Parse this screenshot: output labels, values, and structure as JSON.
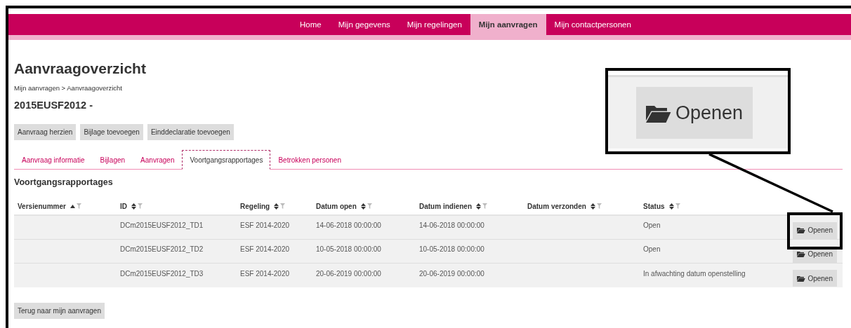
{
  "nav": {
    "items": [
      {
        "label": "Home",
        "selected": false
      },
      {
        "label": "Mijn gegevens",
        "selected": false
      },
      {
        "label": "Mijn regelingen",
        "selected": false
      },
      {
        "label": "Mijn aanvragen",
        "selected": true
      },
      {
        "label": "Mijn contactpersonen",
        "selected": false
      }
    ]
  },
  "title": "Aanvraagoverzicht",
  "breadcrumb": "Mijn aanvragen > Aanvraagoverzicht",
  "case_id": "2015EUSF2012 -",
  "actions": [
    "Aanvraag herzien",
    "Bijlage toevoegen",
    "Einddeclaratie toevoegen"
  ],
  "tabs": [
    {
      "label": "Aanvraag informatie",
      "selected": false
    },
    {
      "label": "Bijlagen",
      "selected": false
    },
    {
      "label": "Aanvragen",
      "selected": false
    },
    {
      "label": "Voortgangsrapportages",
      "selected": true
    },
    {
      "label": "Betrokken personen",
      "selected": false
    }
  ],
  "section_title": "Voortgangsrapportages",
  "table": {
    "columns": [
      {
        "label": "Versienummer",
        "sorted": true
      },
      {
        "label": "ID",
        "sorted": false
      },
      {
        "label": "Regeling",
        "sorted": false
      },
      {
        "label": "Datum open",
        "sorted": false
      },
      {
        "label": "Datum indienen",
        "sorted": false
      },
      {
        "label": "Datum verzonden",
        "sorted": false
      },
      {
        "label": "Status",
        "sorted": false
      }
    ],
    "rows": [
      {
        "id": "DCm2015EUSF2012_TD1",
        "regeling": "ESF 2014-2020",
        "datum_open": "14-06-2018 00:00:00",
        "datum_indienen": "14-06-2018 00:00:00",
        "status": "Open",
        "button": "Openen"
      },
      {
        "id": "DCm2015EUSF2012_TD2",
        "regeling": "ESF 2014-2020",
        "datum_open": "10-05-2018 00:00:00",
        "datum_indienen": "10-05-2018 00:00:00",
        "status": "Open",
        "button": "Openen"
      },
      {
        "id": "DCm2015EUSF2012_TD3",
        "regeling": "ESF 2014-2020",
        "datum_open": "20-06-2019 00:00:00",
        "datum_indienen": "20-06-2019 00:00:00",
        "status": "In afwachting datum openstelling",
        "button": "Openen"
      }
    ]
  },
  "back_button": "Terug naar mijn aanvragen",
  "callout": {
    "button": "Openen"
  }
}
